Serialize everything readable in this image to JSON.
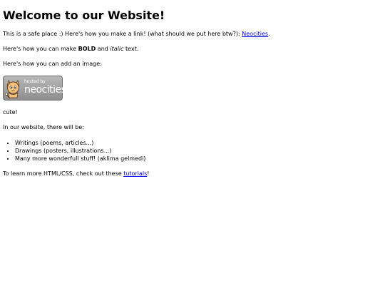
{
  "heading": "Welcome to our Website!",
  "intro": {
    "text": "This is a safe place :) Here's how you make a link! (what should we put here btw?): ",
    "link": "Neocities",
    "end": "."
  },
  "format": {
    "before": "Here's how you can make ",
    "bold": "BOLD",
    "middle": " and ",
    "italic": "italic",
    "after": " text."
  },
  "image_intro": "Here's how you can add an image:",
  "badge": {
    "small": "hosted by",
    "big": "neocities"
  },
  "cute": "cute!",
  "list_intro": "In our website, there will be:",
  "list": [
    "Writings (poems, articles...)",
    "Drawings (posters, illustrations...)",
    "Many more wonderfull stuff! (aklima gelmedi)"
  ],
  "outro": {
    "text": "To learn more HTML/CSS, check out these ",
    "link": "tutorials",
    "end": "!"
  }
}
